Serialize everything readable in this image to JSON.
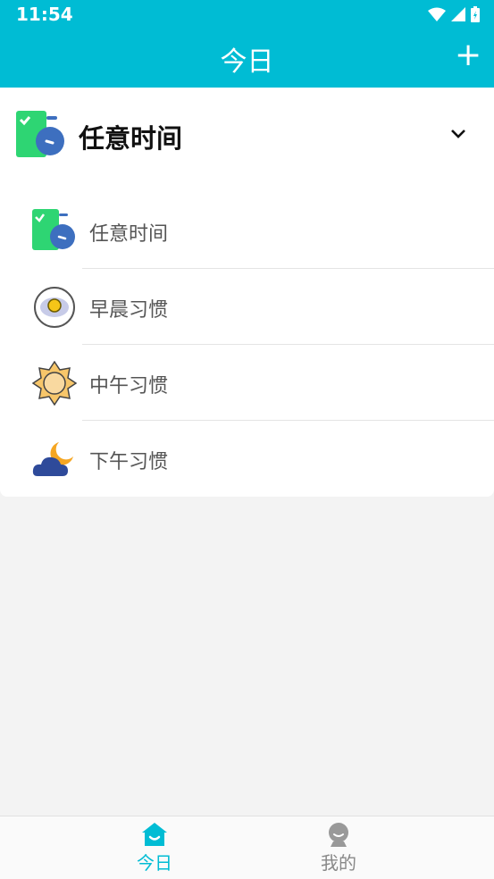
{
  "status_bar": {
    "time": "11:54"
  },
  "app_bar": {
    "title": "今日",
    "add_label": "+"
  },
  "section": {
    "title": "任意时间"
  },
  "list": [
    {
      "label": "任意时间",
      "icon": "stopwatch-icon"
    },
    {
      "label": "早晨习惯",
      "icon": "fried-egg-icon"
    },
    {
      "label": "中午习惯",
      "icon": "sun-icon"
    },
    {
      "label": "下午习惯",
      "icon": "cloud-moon-icon"
    }
  ],
  "tabs": [
    {
      "label": "今日",
      "icon": "home-icon",
      "active": true
    },
    {
      "label": "我的",
      "icon": "profile-icon",
      "active": false
    }
  ],
  "colors": {
    "primary": "#00bcd4",
    "background": "#f3f3f3",
    "inactive": "#888888"
  }
}
